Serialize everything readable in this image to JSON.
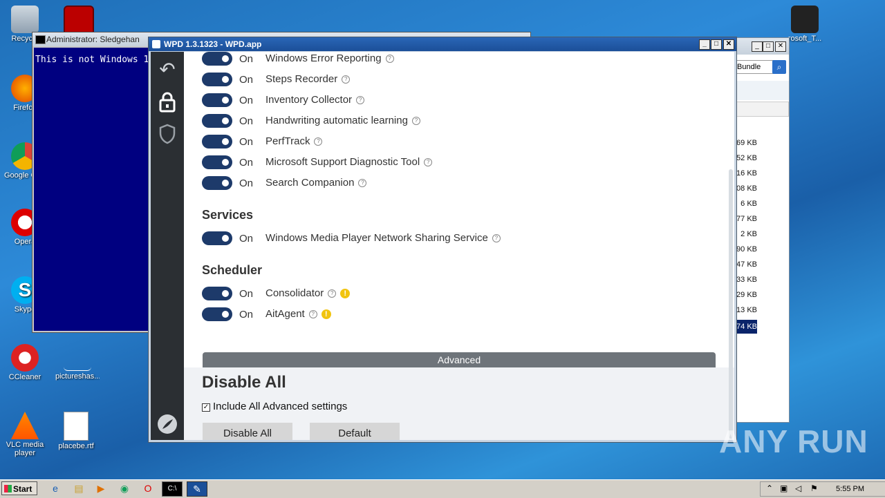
{
  "desktop": {
    "icons": [
      {
        "label": "Recycle",
        "name": "recycle-bin-icon"
      },
      {
        "label": "Firefox",
        "name": "firefox-icon"
      },
      {
        "label": "Google Chrome",
        "name": "chrome-icon"
      },
      {
        "label": "Opera",
        "name": "opera-icon"
      },
      {
        "label": "Skype",
        "name": "skype-icon"
      },
      {
        "label": "CCleaner",
        "name": "ccleaner-icon"
      },
      {
        "label": "pictureshas...",
        "name": "file-icon"
      },
      {
        "label": "VLC media player",
        "name": "vlc-icon"
      },
      {
        "label": "placebe.rtf",
        "name": "word-doc-icon"
      },
      {
        "label": "rosoft_T...",
        "name": "anonymous-mask-icon"
      }
    ]
  },
  "cmd": {
    "title": "Administrator: Sledgehan",
    "text": "This is not Windows 1"
  },
  "explorer": {
    "search_value": "Bundle",
    "sizes": [
      "69 KB",
      "52 KB",
      "16 KB",
      "08 KB",
      "6 KB",
      "77 KB",
      "2 KB",
      "90 KB",
      "47 KB",
      "33 KB",
      "29 KB",
      "13 KB",
      "74 KB"
    ]
  },
  "wpd": {
    "title": "WPD 1.3.1323 - WPD.app",
    "on_label": "On",
    "tweaks": [
      {
        "label": "Windows Error Reporting"
      },
      {
        "label": "Steps Recorder"
      },
      {
        "label": "Inventory Collector"
      },
      {
        "label": "Handwriting automatic learning"
      },
      {
        "label": "PerfTrack"
      },
      {
        "label": "Microsoft Support Diagnostic Tool"
      },
      {
        "label": "Search Companion"
      }
    ],
    "services_title": "Services",
    "services": [
      {
        "label": "Windows Media Player Network Sharing Service"
      }
    ],
    "scheduler_title": "Scheduler",
    "scheduler": [
      {
        "label": "Consolidator"
      },
      {
        "label": "AitAgent"
      }
    ],
    "advanced_label": "Advanced",
    "disable_all_title": "Disable All",
    "include_advanced_label": "Include All Advanced settings",
    "include_advanced_checked": true,
    "disable_all_button": "Disable All",
    "default_button": "Default"
  },
  "taskbar": {
    "start_label": "Start",
    "clock": "5:55 PM"
  },
  "watermark": "ANY RUN"
}
